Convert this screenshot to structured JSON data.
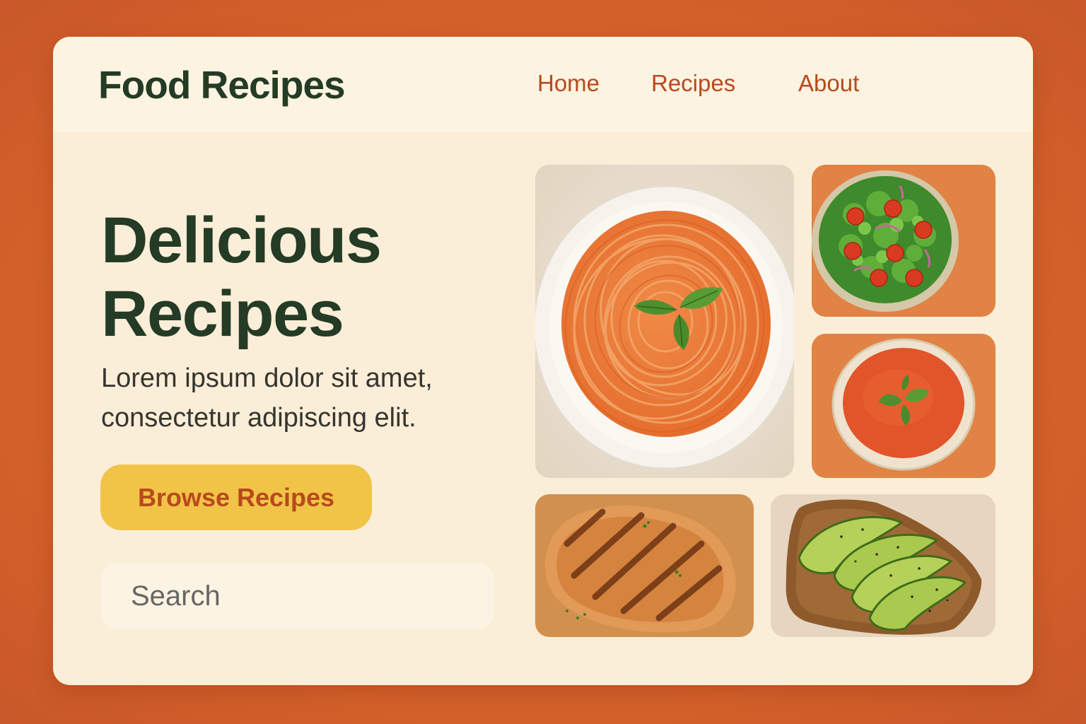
{
  "header": {
    "brand": "Food Recipes",
    "nav": [
      {
        "label": "Home"
      },
      {
        "label": "Recipes"
      },
      {
        "label": "About"
      }
    ]
  },
  "hero": {
    "title_lines": [
      "Delicious",
      "Recipes"
    ],
    "subtitle_lines": [
      "Lorem ipsum dolor sit amet,",
      "consectetur adipiscing elit."
    ],
    "cta_label": "Browse Recipes"
  },
  "search": {
    "placeholder": "Search",
    "value": ""
  },
  "gallery": [
    {
      "name": "spaghetti-photo"
    },
    {
      "name": "salad-photo"
    },
    {
      "name": "tomato-soup-photo"
    },
    {
      "name": "grilled-chicken-photo"
    },
    {
      "name": "avocado-toast-photo"
    }
  ],
  "colors": {
    "page_background": "#d8652a",
    "card_background": "#fbeed8",
    "header_background": "#fdf3e1",
    "heading_text": "#243b25",
    "nav_text": "#b8491d",
    "cta_background": "#f1c447",
    "cta_text": "#b8491d"
  }
}
